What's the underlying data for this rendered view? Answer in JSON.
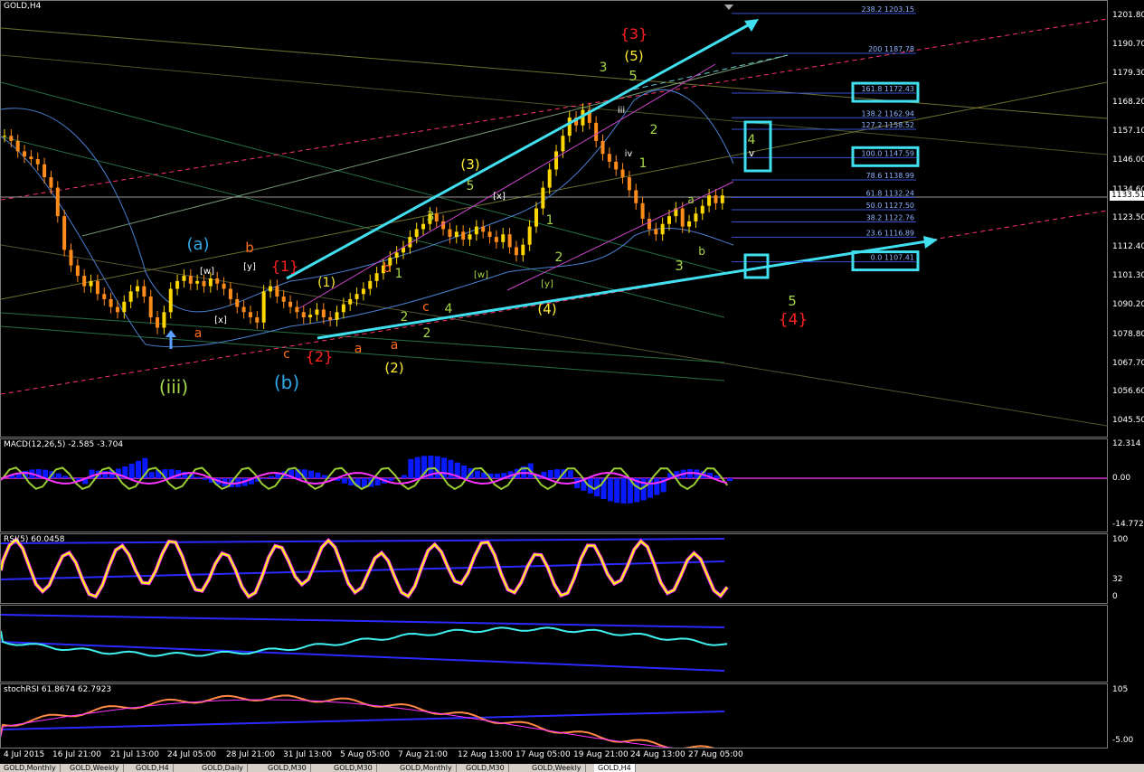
{
  "window": {
    "title": "GOLD,H4"
  },
  "colors": {
    "background": "#000000",
    "bull_candle": "#ffd700",
    "bear_candle": "#ff8c1a",
    "trend": "#40e0f0",
    "fib_text": "#8fb3ff",
    "wave_yellow": "#ffee33",
    "wave_red": "#ff2020",
    "wave_orange": "#ff6a1a",
    "wave_green": "#a8d848",
    "wave_blue": "#30a8e8",
    "wave_violet": "#cc66cc",
    "macd_hist": "#0a1aff",
    "macd_signal": "#ff33ff",
    "rsi_line": "#ffff00",
    "cyan_line": "#40f0f0"
  },
  "price_axis": {
    "labels": [
      "1201.80",
      "1190.70",
      "1179.30",
      "1168.20",
      "1157.10",
      "1146.00",
      "1134.60",
      "1123.50",
      "1112.40",
      "1101.30",
      "1090.20",
      "1078.80",
      "1067.70",
      "1056.60",
      "1045.50"
    ],
    "current_price": "1133.51"
  },
  "time_axis": {
    "labels": [
      "4 Jul 2015",
      "16 Jul 21:00",
      "21 Jul 13:00",
      "24 Jul 05:00",
      "28 Jul 21:00",
      "31 Jul 13:00",
      "5 Aug 05:00",
      "7 Aug 21:00",
      "12 Aug 13:00",
      "17 Aug 05:00",
      "19 Aug 21:00",
      "24 Aug 13:00",
      "27 Aug 05:00"
    ]
  },
  "fib_levels": [
    {
      "label": "238.2 1203.15",
      "boxed": false
    },
    {
      "label": "200 1187.78",
      "boxed": false
    },
    {
      "label": "161.8 1172.43",
      "boxed": true
    },
    {
      "label": "138.2 1162.94",
      "boxed": false
    },
    {
      "label": "127.2 1158.52",
      "boxed": false
    },
    {
      "label": "100.0 1147.59",
      "boxed": true
    },
    {
      "label": "78.6 1138.99",
      "boxed": false
    },
    {
      "label": "61.8 1132.24",
      "boxed": false
    },
    {
      "label": "50.0 1127.50",
      "boxed": false
    },
    {
      "label": "38.2 1122.76",
      "boxed": false
    },
    {
      "label": "23.6 1116.89",
      "boxed": false
    },
    {
      "label": "0.0 1107.41",
      "boxed": true
    }
  ],
  "wave_labels": [
    {
      "t": "{3}",
      "c": "wave_red"
    },
    {
      "t": "(5)",
      "c": "wave_yellow"
    },
    {
      "t": "3",
      "c": "wave_green"
    },
    {
      "t": "5",
      "c": "wave_green"
    },
    {
      "t": "(3)",
      "c": "wave_yellow"
    },
    {
      "t": "5",
      "c": "wave_green"
    },
    {
      "t": "3",
      "c": "wave_green"
    },
    {
      "t": "{1}",
      "c": "wave_red"
    },
    {
      "t": "(1)",
      "c": "wave_yellow"
    },
    {
      "t": "(a)",
      "c": "wave_blue"
    },
    {
      "t": "b",
      "c": "wave_orange"
    },
    {
      "t": "(b)",
      "c": "wave_blue"
    },
    {
      "t": "(iii)",
      "c": "wave_green"
    },
    {
      "t": "{2}",
      "c": "wave_red"
    },
    {
      "t": "(2)",
      "c": "wave_yellow"
    },
    {
      "t": "(4)",
      "c": "wave_yellow"
    },
    {
      "t": "4",
      "c": "wave_green"
    },
    {
      "t": "5",
      "c": "wave_green"
    },
    {
      "t": "{4}",
      "c": "wave_red"
    },
    {
      "t": "1",
      "c": "wave_green"
    },
    {
      "t": "2",
      "c": "wave_green"
    },
    {
      "t": "b",
      "c": "wave_orange"
    },
    {
      "t": "2",
      "c": "wave_green"
    },
    {
      "t": "a",
      "c": "wave_orange"
    },
    {
      "t": "c",
      "c": "wave_orange"
    },
    {
      "t": "a",
      "c": "wave_orange"
    },
    {
      "t": "a",
      "c": "wave_orange"
    },
    {
      "t": "c",
      "c": "wave_orange"
    },
    {
      "t": "1",
      "c": "wave_green"
    },
    {
      "t": "2",
      "c": "wave_green"
    },
    {
      "t": "4",
      "c": "wave_green"
    },
    {
      "t": "3",
      "c": "wave_green"
    },
    {
      "t": "2",
      "c": "wave_green"
    },
    {
      "t": "1",
      "c": "wave_green"
    },
    {
      "t": "3",
      "c": "wave_green"
    },
    {
      "t": "b",
      "c": "wave_green"
    },
    {
      "t": "a",
      "c": "wave_green"
    },
    {
      "t": "[w]",
      "c": "white"
    },
    {
      "t": "[y]",
      "c": "white"
    },
    {
      "t": "[x]",
      "c": "white"
    },
    {
      "t": "[x]",
      "c": "white"
    },
    {
      "t": "[w]",
      "c": "wave_green"
    },
    {
      "t": "[y]",
      "c": "wave_green"
    },
    {
      "t": "iii",
      "c": "white"
    },
    {
      "t": "iv",
      "c": "white"
    },
    {
      "t": "v",
      "c": "white"
    }
  ],
  "indicators": {
    "macd": {
      "title": "MACD(12,26,5) -2.585 -3.704",
      "scale": [
        "12.314",
        "0.00",
        "-14.772"
      ]
    },
    "rsi": {
      "title": "RSI(5) 60.0458",
      "scale": [
        "100",
        "32",
        "0"
      ]
    },
    "cyan": {
      "title": ""
    },
    "stoch": {
      "title": "stochRSI 61.8674 62.7923",
      "scale": [
        "105",
        "-5.00"
      ]
    }
  },
  "tabs": [
    {
      "label": "GOLD,Monthly",
      "active": false
    },
    {
      "label": "GOLD,Weekly",
      "active": false
    },
    {
      "label": "GOLD,H4",
      "active": false
    },
    {
      "label": "GOLD,Daily",
      "active": false
    },
    {
      "label": "GOLD,M30",
      "active": false
    },
    {
      "label": "GOLD,M30",
      "active": false
    },
    {
      "label": "GOLD,Monthly",
      "active": false
    },
    {
      "label": "GOLD,M30",
      "active": false
    },
    {
      "label": "GOLD,Weekly",
      "active": false
    },
    {
      "label": "GOLD,H4",
      "active": true
    }
  ],
  "chart_data": {
    "type": "candlestick",
    "title": "GOLD,H4",
    "ylim": [
      1040,
      1208
    ],
    "close_path": [
      1156,
      1154,
      1150,
      1148,
      1147,
      1145,
      1140,
      1136,
      1125,
      1112,
      1106,
      1102,
      1098,
      1100,
      1095,
      1093,
      1090,
      1088,
      1092,
      1096,
      1098,
      1094,
      1086,
      1082,
      1088,
      1097,
      1100,
      1102,
      1099,
      1100,
      1098,
      1101,
      1099,
      1097,
      1093,
      1090,
      1088,
      1086,
      1084,
      1096,
      1098,
      1094,
      1092,
      1090,
      1088,
      1086,
      1087,
      1089,
      1086,
      1085,
      1088,
      1091,
      1093,
      1095,
      1097,
      1100,
      1103,
      1106,
      1109,
      1111,
      1113,
      1117,
      1120,
      1122,
      1126,
      1123,
      1120,
      1117,
      1119,
      1116,
      1118,
      1121,
      1119,
      1117,
      1115,
      1118,
      1113,
      1110,
      1114,
      1121,
      1128,
      1136,
      1143,
      1150,
      1156,
      1163,
      1160,
      1166,
      1161,
      1154,
      1149,
      1146,
      1143,
      1140,
      1135,
      1130,
      1124,
      1120,
      1118,
      1122,
      1125,
      1128,
      1121,
      1123,
      1126,
      1129,
      1133,
      1130,
      1133
    ]
  }
}
